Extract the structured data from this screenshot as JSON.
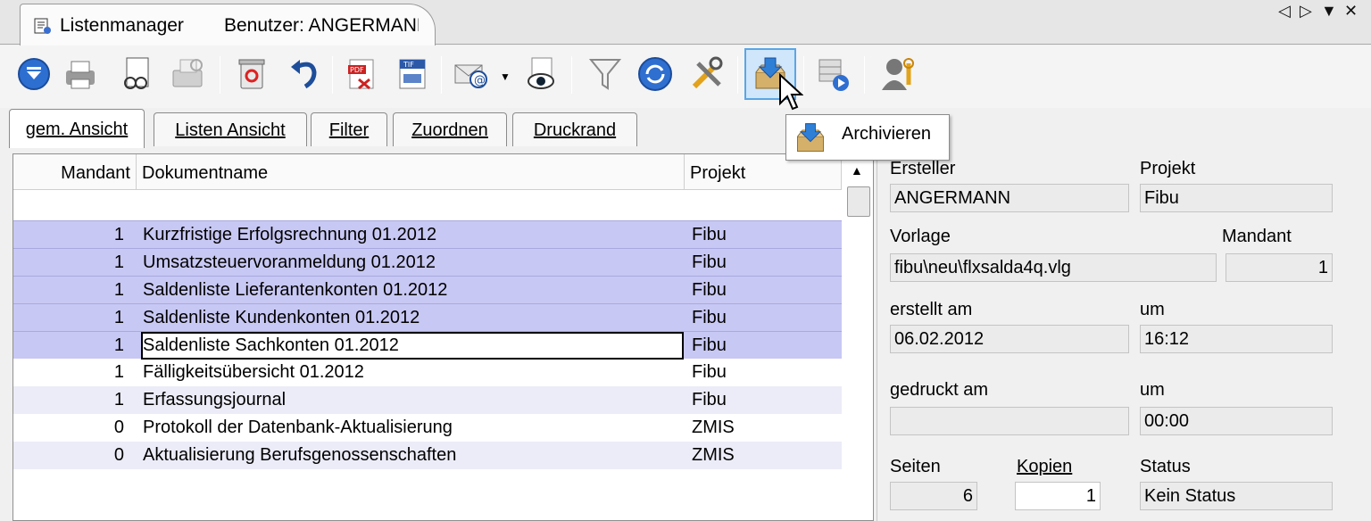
{
  "window": {
    "tab_title": "Listenmanager",
    "tab_user": "Benutzer: ANGERMANN",
    "controls": [
      "◁",
      "▷",
      "▼",
      "✕"
    ]
  },
  "toolbar": {
    "buttons": [
      {
        "icon": "dropdown-menu-icon"
      },
      {
        "icon": "printer-icon"
      },
      {
        "icon": "preview-print-icon"
      },
      {
        "icon": "fax-icon"
      },
      {
        "icon": "delete-icon"
      },
      {
        "icon": "undo-icon"
      },
      {
        "icon": "pdf-export-icon"
      },
      {
        "icon": "tif-export-icon"
      },
      {
        "icon": "email-icon"
      },
      {
        "icon": "view-icon"
      },
      {
        "icon": "filter-icon"
      },
      {
        "icon": "refresh-icon"
      },
      {
        "icon": "tools-icon"
      },
      {
        "icon": "archive-icon"
      },
      {
        "icon": "stack-play-icon"
      },
      {
        "icon": "user-settings-icon"
      }
    ]
  },
  "tooltip": {
    "text": "Archivieren"
  },
  "tabs": [
    "gem. Ansicht",
    "Listen Ansicht",
    "Filter",
    "Zuordnen",
    "Druckrand"
  ],
  "grid": {
    "columns": [
      "Mandant",
      "Dokumentname",
      "Projekt"
    ],
    "rows": [
      {
        "mandant": "1",
        "name": "Kurzfristige Erfolgsrechnung 01.2012",
        "projekt": "Fibu"
      },
      {
        "mandant": "1",
        "name": "Umsatzsteuervoranmeldung 01.2012",
        "projekt": "Fibu"
      },
      {
        "mandant": "1",
        "name": "Saldenliste Lieferantenkonten 01.2012",
        "projekt": "Fibu"
      },
      {
        "mandant": "1",
        "name": "Saldenliste Kundenkonten 01.2012",
        "projekt": "Fibu"
      },
      {
        "mandant": "1",
        "name": "Saldenliste Sachkonten 01.2012",
        "projekt": "Fibu"
      },
      {
        "mandant": "1",
        "name": "Fälligkeitsübersicht 01.2012",
        "projekt": "Fibu"
      },
      {
        "mandant": "1",
        "name": "Erfassungsjournal",
        "projekt": "Fibu"
      },
      {
        "mandant": "0",
        "name": "Protokoll der Datenbank-Aktualisierung",
        "projekt": "ZMIS"
      },
      {
        "mandant": "0",
        "name": "Aktualisierung Berufsgenossenschaften",
        "projekt": "ZMIS"
      }
    ]
  },
  "detail": {
    "ersteller_label": "Ersteller",
    "ersteller": "ANGERMANN",
    "projekt_label": "Projekt",
    "projekt": "Fibu",
    "vorlage_label": "Vorlage",
    "vorlage": "fibu\\neu\\flxsalda4q.vlg",
    "mandant_label": "Mandant",
    "mandant": "1",
    "erstellt_label": "erstellt am",
    "erstellt": "06.02.2012",
    "um_label": "um",
    "erstellt_um": "16:12",
    "gedruckt_label": "gedruckt am",
    "gedruckt": "",
    "gedruckt_um": "00:00",
    "seiten_label": "Seiten",
    "seiten": "6",
    "kopien_label": "Kopien",
    "kopien": "1",
    "status_label": "Status",
    "status": "Kein Status"
  },
  "colors": {
    "selection": "#c8c8f4",
    "accent": "#5aa6e6"
  }
}
